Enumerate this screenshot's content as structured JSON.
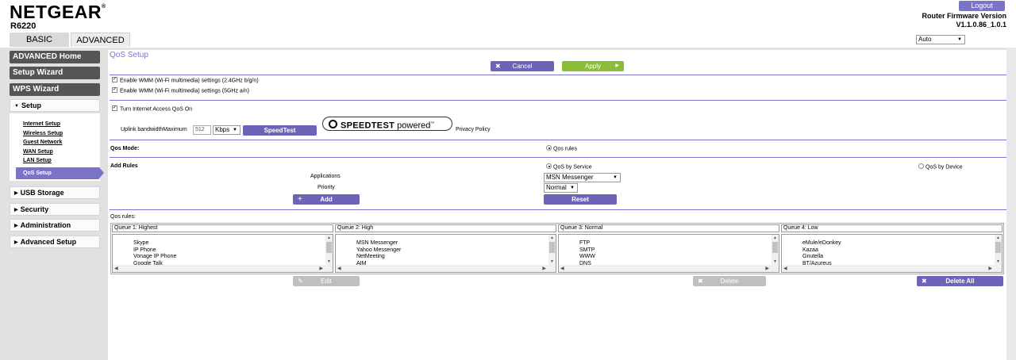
{
  "header": {
    "brand": "NETGEAR",
    "trademark": "®",
    "model": "R6220",
    "tabs": [
      "BASIC",
      "ADVANCED"
    ],
    "logout": "Logout",
    "firmware_label": "Router Firmware Version",
    "firmware_version": "V1.1.0.86_1.0.1",
    "language": "Auto"
  },
  "sidebar": {
    "main_buttons": [
      "ADVANCED Home",
      "Setup Wizard",
      "WPS Wizard"
    ],
    "setup_section": "Setup",
    "setup_links": [
      "Internet Setup",
      "Wireless Setup",
      "Guest Network",
      "WAN Setup",
      "LAN Setup"
    ],
    "setup_active": "QoS Setup",
    "sections": [
      "USB Storage",
      "Security",
      "Administration",
      "Advanced Setup"
    ]
  },
  "main": {
    "title": "QoS Setup",
    "cancel": "Cancel",
    "apply": "Apply",
    "wmm_24": "Enable WMM (Wi-Fi multimedia) settings (2.4GHz b/g/n)",
    "wmm_5": "Enable WMM (Wi-Fi multimedia) settings (5GHz a/n)",
    "qos_on": "Turn Internet Access QoS On",
    "uplink_label": "Uplink bandwidthMaximum",
    "uplink_value": "512",
    "uplink_unit": "Kbps",
    "speedtest_button": "SpeedTest",
    "speedtest_logo_bold": "SPEEDTEST",
    "speedtest_logo_light": " powered",
    "speedtest_logo_mark": "™",
    "privacy_policy": "Privacy Policy",
    "qos_mode_label": "Qos Mode:",
    "qos_rules_option": "Qos rules",
    "add_rules_label": "Add Rules",
    "qos_by_service": "QoS by Service",
    "qos_by_device": "QoS by Device",
    "applications_label": "Applications",
    "applications_value": "MSN Messenger",
    "priority_label": "Priority",
    "priority_value": "Normal",
    "add": "Add",
    "reset": "Reset",
    "qos_rules_label": "Qos rules:",
    "queues": [
      {
        "name": "Queue 1: Highest",
        "items": [
          "Skype",
          "IP Phone",
          "Vonage IP Phone",
          "Google Talk"
        ]
      },
      {
        "name": "Queue 2: High",
        "items": [
          "MSN Messenger",
          "Yahoo Messenger",
          "NetMeeting",
          "AIM"
        ]
      },
      {
        "name": "Queue 3: Normal",
        "items": [
          "FTP",
          "SMTP",
          "WWW",
          "DNS"
        ]
      },
      {
        "name": "Queue 4: Low",
        "items": [
          "eMule/eDonkey",
          "Kazaa",
          "Gnutella",
          "BT/Azureus"
        ]
      }
    ],
    "edit": "Edit",
    "delete": "Delete",
    "delete_all": "Delete All"
  },
  "colors": {
    "accent": "#7a74c8",
    "button_purple": "#6c64b8",
    "button_green": "#8bbd3a",
    "nav_dark": "#555555"
  }
}
